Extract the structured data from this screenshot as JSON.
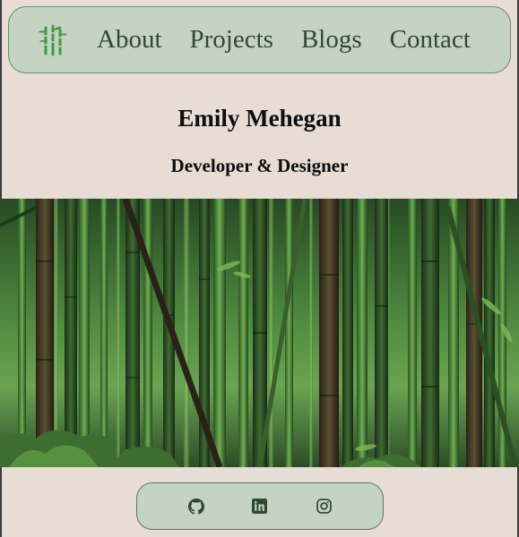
{
  "nav": {
    "logo_icon": "bamboo-icon",
    "links": [
      {
        "label": "About"
      },
      {
        "label": "Projects"
      },
      {
        "label": "Blogs"
      },
      {
        "label": "Contact"
      }
    ]
  },
  "hero": {
    "name": "Emily Mehegan",
    "tagline": "Developer & Designer"
  },
  "banner": {
    "image_subject": "bamboo-forest-image"
  },
  "social": {
    "icons": [
      "github-icon",
      "linkedin-icon",
      "instagram-icon"
    ]
  },
  "colors": {
    "background": "#e8ddd5",
    "nav_background": "#c5d3c2",
    "nav_text": "#2f4a2f",
    "accent_green": "#3f9a45",
    "icon_color": "#2e4a2e"
  }
}
